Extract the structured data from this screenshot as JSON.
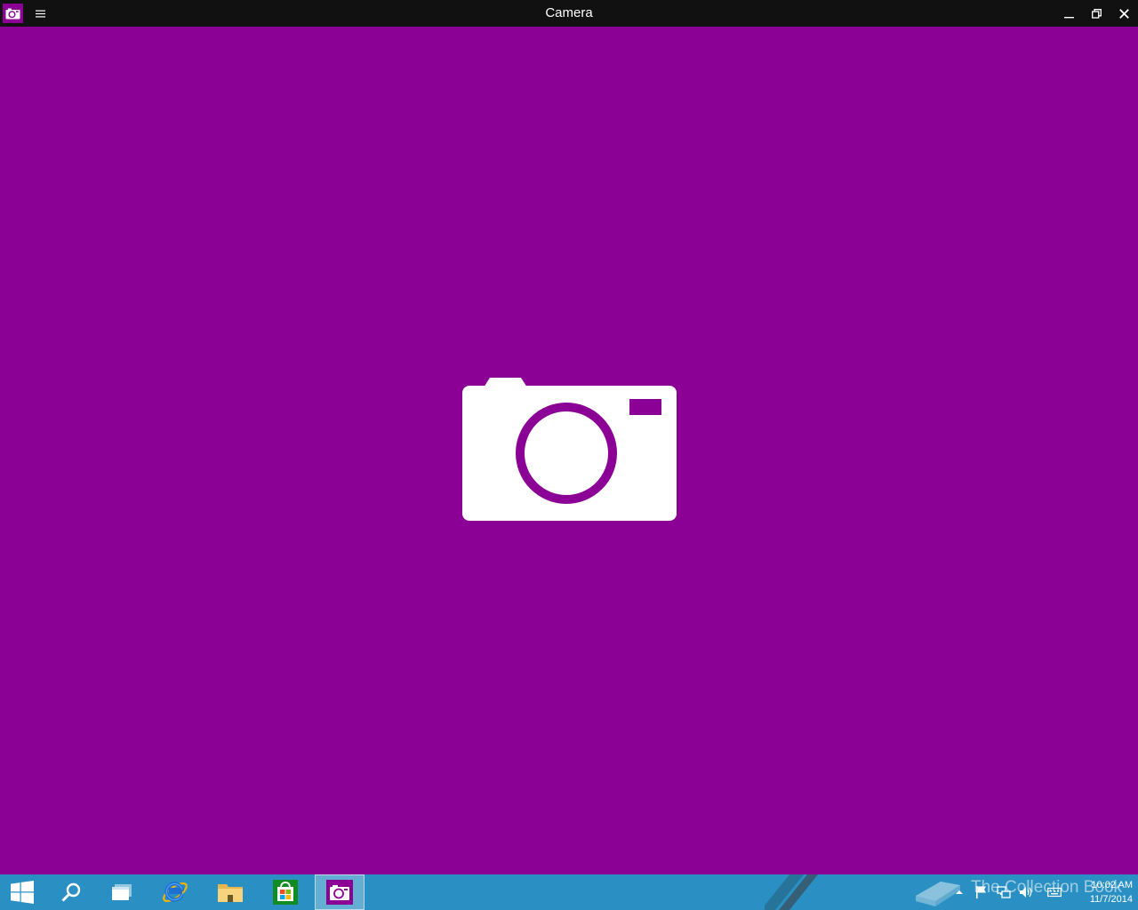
{
  "window": {
    "title": "Camera"
  },
  "colors": {
    "accent": "#8b0095",
    "titlebar": "#111111",
    "taskbar": "#2a8fc2",
    "icon_white": "#ffffff"
  },
  "icons": {
    "app": "camera-icon",
    "menu": "hamburger-menu-icon",
    "minimize": "minimize-icon",
    "restore": "restore-icon",
    "close": "close-icon",
    "splash": "camera-icon"
  },
  "taskbar": {
    "items": [
      {
        "name": "start",
        "icon": "windows-logo-icon"
      },
      {
        "name": "search",
        "icon": "search-icon"
      },
      {
        "name": "task-view",
        "icon": "task-view-icon"
      },
      {
        "name": "internet-explorer",
        "icon": "internet-explorer-icon"
      },
      {
        "name": "file-explorer",
        "icon": "folder-icon"
      },
      {
        "name": "store",
        "icon": "store-icon"
      },
      {
        "name": "camera",
        "icon": "camera-icon",
        "active": true
      }
    ],
    "watermark": "The Collection Book",
    "tray": [
      "chevron-up-icon",
      "flag-icon",
      "network-icon",
      "volume-icon",
      "keyboard-icon"
    ],
    "clock": {
      "time": "10:02 AM",
      "date": "11/7/2014"
    }
  }
}
